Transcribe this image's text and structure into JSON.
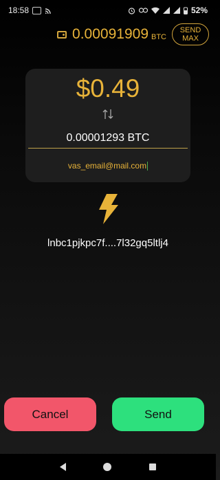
{
  "status": {
    "time": "18:58",
    "battery": "52%",
    "icons": [
      "sd-card-icon",
      "cast-icon",
      "alarm-icon",
      "link-icon",
      "wifi-icon",
      "signal-icon",
      "signal-icon",
      "battery-icon"
    ]
  },
  "header": {
    "balance_amount": "0.00091909",
    "balance_unit": "BTC",
    "send_max_label": "SEND MAX",
    "wallet_icon": "wallet-icon"
  },
  "amount": {
    "fiat": "$0.49",
    "btc": "0.00001293 BTC",
    "swap_icon": "swap-vertical-icon"
  },
  "email": {
    "value": "vas_email@mail.com"
  },
  "invoice": {
    "icon": "lightning-bolt-icon",
    "text": "lnbc1pjkpc7f....7l32gq5ltlj4"
  },
  "actions": {
    "cancel_label": "Cancel",
    "send_label": "Send"
  },
  "colors": {
    "accent": "#e8b339",
    "cancel": "#f2566a",
    "send": "#2de07d",
    "card": "#1e1e1e"
  }
}
